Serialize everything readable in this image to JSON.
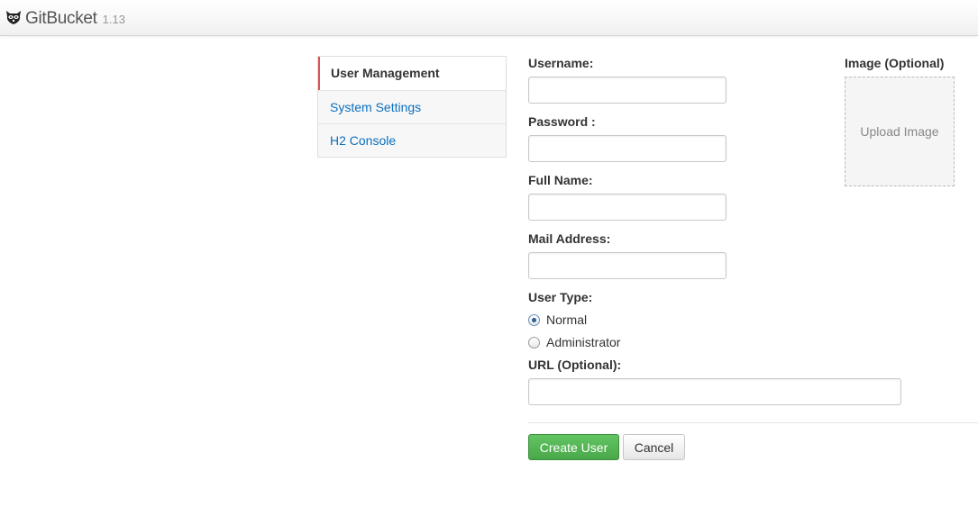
{
  "navbar": {
    "brand_name": "GitBucket",
    "version": "1.13",
    "logo_icon": "raccoon-logo-icon"
  },
  "sidebar": {
    "items": [
      {
        "label": "User Management",
        "active": true
      },
      {
        "label": "System Settings",
        "active": false
      },
      {
        "label": "H2 Console",
        "active": false
      }
    ]
  },
  "form": {
    "username": {
      "label": "Username:",
      "value": ""
    },
    "password": {
      "label": "Password :",
      "value": ""
    },
    "full_name": {
      "label": "Full Name:",
      "value": ""
    },
    "mail_address": {
      "label": "Mail Address:",
      "value": ""
    },
    "user_type": {
      "label": "User Type:",
      "options": [
        {
          "label": "Normal",
          "checked": true
        },
        {
          "label": "Administrator",
          "checked": false
        }
      ]
    },
    "url": {
      "label": "URL (Optional):",
      "value": ""
    },
    "image": {
      "label": "Image (Optional)",
      "upload_label": "Upload Image"
    },
    "buttons": {
      "create": "Create User",
      "cancel": "Cancel"
    }
  },
  "colors": {
    "link": "#0a6fbd",
    "success": "#4aa84a",
    "active_marker": "#d9534f"
  }
}
